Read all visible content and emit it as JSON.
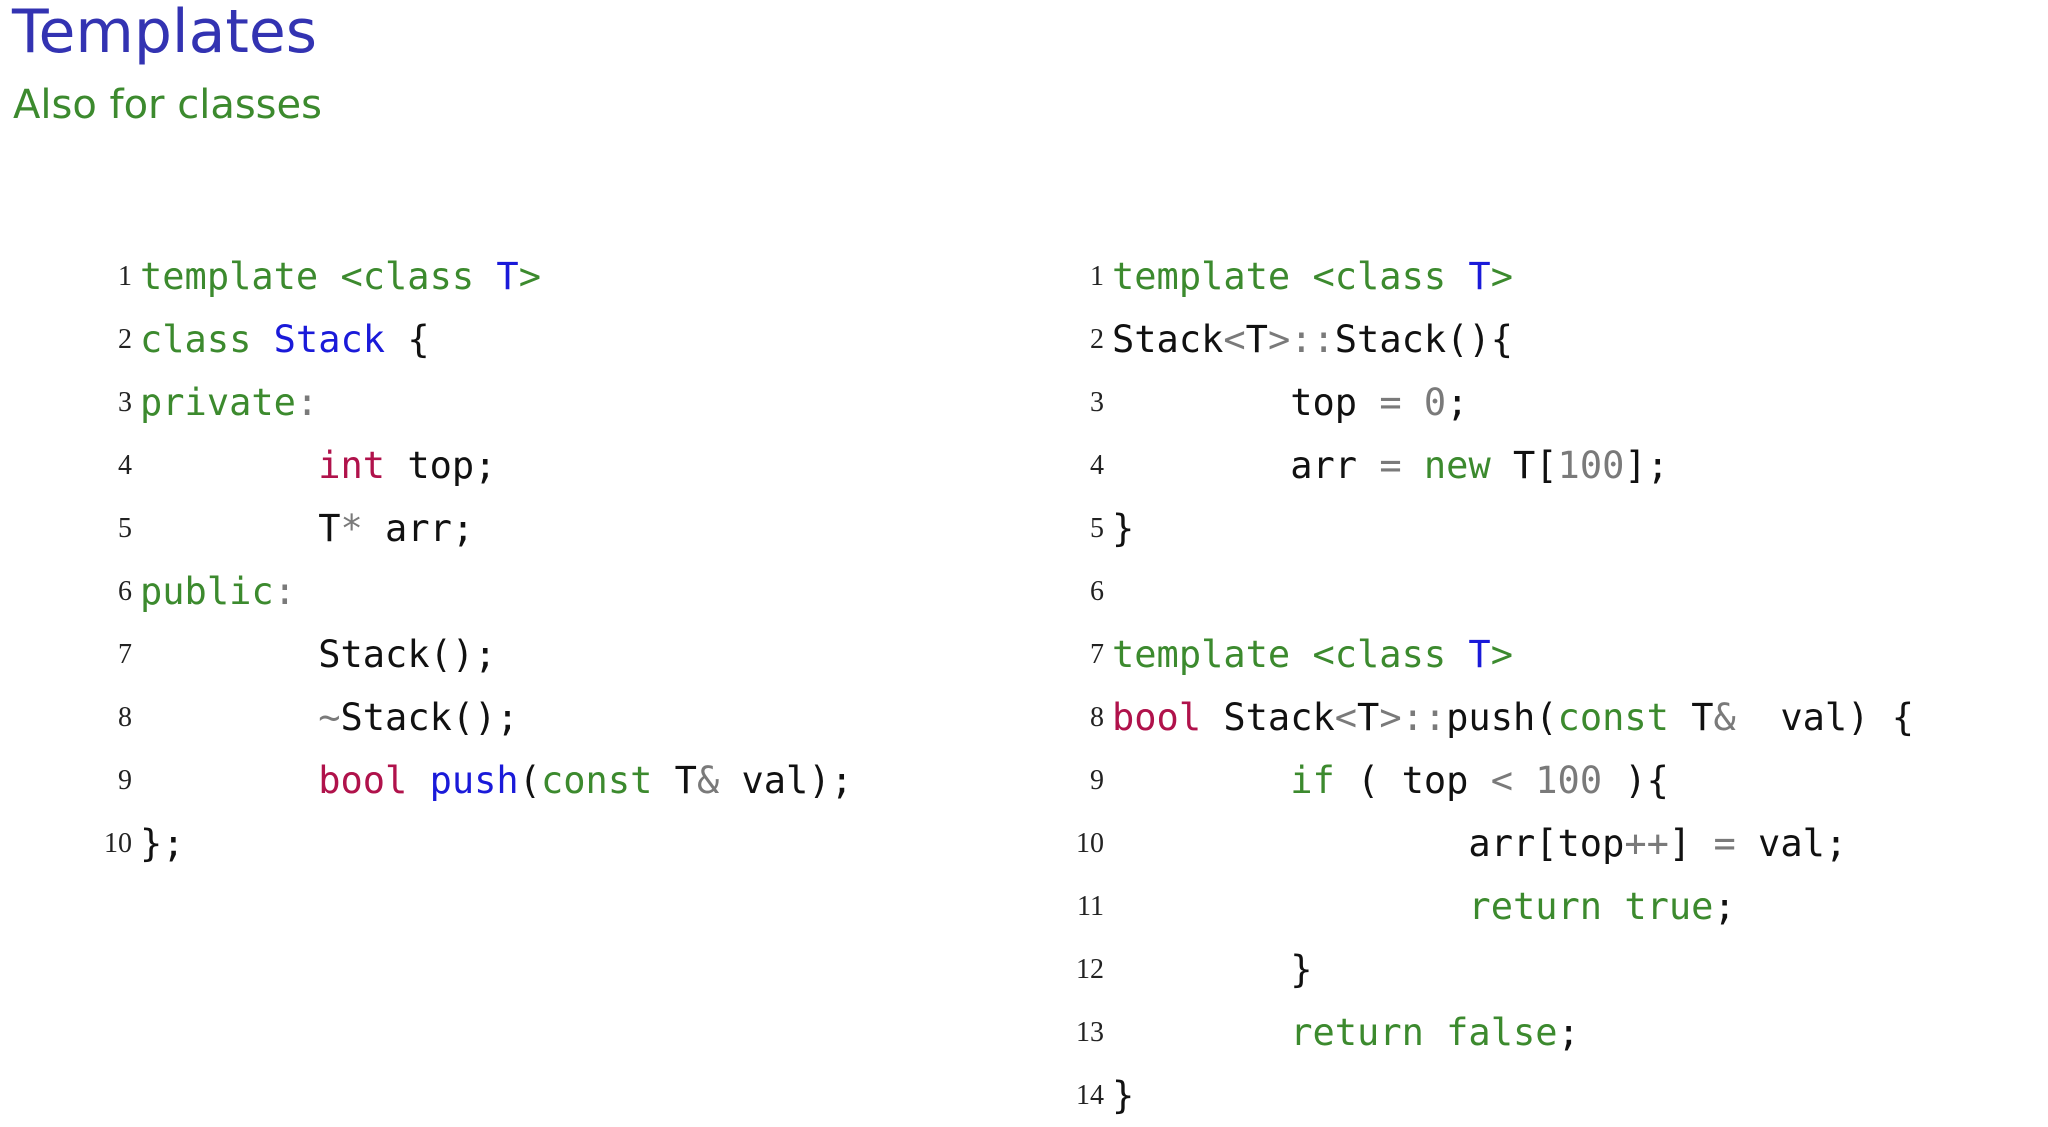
{
  "slide": {
    "title": "Templates",
    "subtitle": "Also for classes"
  },
  "colors": {
    "title": "#3333b2",
    "subtitle": "#3c8a2e",
    "keyword": "#3c8a2e",
    "type": "#b0124b",
    "name": "#1a1ad9",
    "operator": "#7a7a7a",
    "plain": "#111111"
  },
  "code_left": {
    "lines": [
      {
        "no": "1",
        "indent": "",
        "tokens": [
          {
            "t": "template <class ",
            "c": "kw"
          },
          {
            "t": "T",
            "c": "name"
          },
          {
            "t": ">",
            "c": "kw"
          }
        ]
      },
      {
        "no": "2",
        "indent": "",
        "tokens": [
          {
            "t": "class ",
            "c": "kw"
          },
          {
            "t": "Stack",
            "c": "name"
          },
          {
            "t": " {",
            "c": "plain"
          }
        ]
      },
      {
        "no": "3",
        "indent": "",
        "tokens": [
          {
            "t": "private",
            "c": "kw"
          },
          {
            "t": ":",
            "c": "op"
          }
        ]
      },
      {
        "no": "4",
        "indent": "        ",
        "tokens": [
          {
            "t": "int",
            "c": "type"
          },
          {
            "t": " top;",
            "c": "plain"
          }
        ]
      },
      {
        "no": "5",
        "indent": "        ",
        "tokens": [
          {
            "t": "T",
            "c": "plain"
          },
          {
            "t": "*",
            "c": "op"
          },
          {
            "t": " arr;",
            "c": "plain"
          }
        ]
      },
      {
        "no": "6",
        "indent": "",
        "tokens": [
          {
            "t": "public",
            "c": "kw"
          },
          {
            "t": ":",
            "c": "op"
          }
        ]
      },
      {
        "no": "7",
        "indent": "        ",
        "tokens": [
          {
            "t": "Stack();",
            "c": "plain"
          }
        ]
      },
      {
        "no": "8",
        "indent": "        ",
        "tokens": [
          {
            "t": "~",
            "c": "op"
          },
          {
            "t": "Stack();",
            "c": "plain"
          }
        ]
      },
      {
        "no": "9",
        "indent": "        ",
        "tokens": [
          {
            "t": "bool",
            "c": "type"
          },
          {
            "t": " ",
            "c": "plain"
          },
          {
            "t": "push",
            "c": "name"
          },
          {
            "t": "(",
            "c": "plain"
          },
          {
            "t": "const",
            "c": "kw"
          },
          {
            "t": " T",
            "c": "plain"
          },
          {
            "t": "&",
            "c": "op"
          },
          {
            "t": " val);",
            "c": "plain"
          }
        ]
      },
      {
        "no": "10",
        "indent": "",
        "tokens": [
          {
            "t": "};",
            "c": "plain"
          }
        ]
      }
    ]
  },
  "code_right": {
    "lines": [
      {
        "no": "1",
        "indent": "",
        "tokens": [
          {
            "t": "template <class ",
            "c": "kw"
          },
          {
            "t": "T",
            "c": "name"
          },
          {
            "t": ">",
            "c": "kw"
          }
        ]
      },
      {
        "no": "2",
        "indent": "",
        "tokens": [
          {
            "t": "Stack",
            "c": "plain"
          },
          {
            "t": "<",
            "c": "op"
          },
          {
            "t": "T",
            "c": "plain"
          },
          {
            "t": ">::",
            "c": "op"
          },
          {
            "t": "Stack(){",
            "c": "plain"
          }
        ]
      },
      {
        "no": "3",
        "indent": "        ",
        "tokens": [
          {
            "t": "top ",
            "c": "plain"
          },
          {
            "t": "=",
            "c": "op"
          },
          {
            "t": " ",
            "c": "plain"
          },
          {
            "t": "0",
            "c": "num"
          },
          {
            "t": ";",
            "c": "plain"
          }
        ]
      },
      {
        "no": "4",
        "indent": "        ",
        "tokens": [
          {
            "t": "arr ",
            "c": "plain"
          },
          {
            "t": "=",
            "c": "op"
          },
          {
            "t": " ",
            "c": "plain"
          },
          {
            "t": "new",
            "c": "kw"
          },
          {
            "t": " T[",
            "c": "plain"
          },
          {
            "t": "100",
            "c": "num"
          },
          {
            "t": "];",
            "c": "plain"
          }
        ]
      },
      {
        "no": "5",
        "indent": "",
        "tokens": [
          {
            "t": "}",
            "c": "plain"
          }
        ]
      },
      {
        "no": "6",
        "indent": "",
        "tokens": []
      },
      {
        "no": "7",
        "indent": "",
        "tokens": [
          {
            "t": "template <class ",
            "c": "kw"
          },
          {
            "t": "T",
            "c": "name"
          },
          {
            "t": ">",
            "c": "kw"
          }
        ]
      },
      {
        "no": "8",
        "indent": "",
        "tokens": [
          {
            "t": "bool",
            "c": "type"
          },
          {
            "t": " Stack",
            "c": "plain"
          },
          {
            "t": "<",
            "c": "op"
          },
          {
            "t": "T",
            "c": "plain"
          },
          {
            "t": ">::",
            "c": "op"
          },
          {
            "t": "push(",
            "c": "plain"
          },
          {
            "t": "const",
            "c": "kw"
          },
          {
            "t": " T",
            "c": "plain"
          },
          {
            "t": "&",
            "c": "op"
          },
          {
            "t": "  val) {",
            "c": "plain"
          }
        ]
      },
      {
        "no": "9",
        "indent": "        ",
        "tokens": [
          {
            "t": "if",
            "c": "kw"
          },
          {
            "t": " ( top ",
            "c": "plain"
          },
          {
            "t": "<",
            "c": "op"
          },
          {
            "t": " ",
            "c": "plain"
          },
          {
            "t": "100",
            "c": "num"
          },
          {
            "t": " ){",
            "c": "plain"
          }
        ]
      },
      {
        "no": "10",
        "indent": "                ",
        "tokens": [
          {
            "t": "arr[top",
            "c": "plain"
          },
          {
            "t": "++",
            "c": "op"
          },
          {
            "t": "] ",
            "c": "plain"
          },
          {
            "t": "=",
            "c": "op"
          },
          {
            "t": " val;",
            "c": "plain"
          }
        ]
      },
      {
        "no": "11",
        "indent": "                ",
        "tokens": [
          {
            "t": "return true",
            "c": "kw"
          },
          {
            "t": ";",
            "c": "plain"
          }
        ]
      },
      {
        "no": "12",
        "indent": "        ",
        "tokens": [
          {
            "t": "}",
            "c": "plain"
          }
        ]
      },
      {
        "no": "13",
        "indent": "        ",
        "tokens": [
          {
            "t": "return false",
            "c": "kw"
          },
          {
            "t": ";",
            "c": "plain"
          }
        ]
      },
      {
        "no": "14",
        "indent": "",
        "tokens": [
          {
            "t": "}",
            "c": "plain"
          }
        ]
      }
    ]
  }
}
